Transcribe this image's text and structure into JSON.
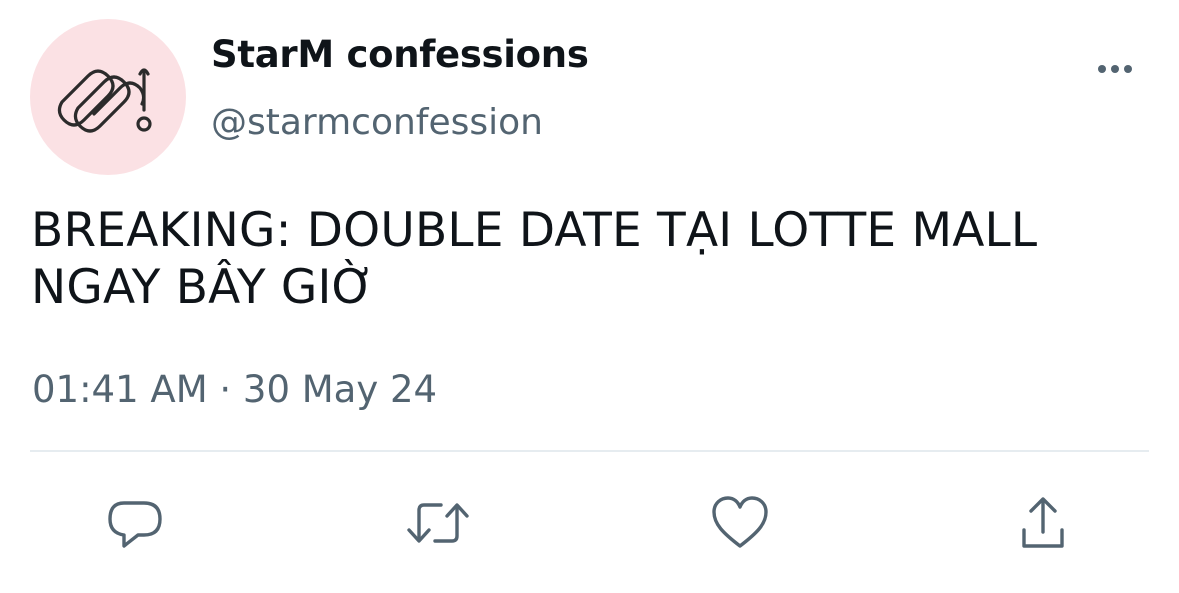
{
  "account": {
    "display_name": "StarM confessions",
    "handle": "@starmconfession",
    "avatar_icon": "starm-logo-icon",
    "avatar_bg": "#fbe1e4"
  },
  "tweet": {
    "text": "BREAKING: DOUBLE DATE TẠI LOTTE MALL NGAY BÂY GIỜ",
    "timestamp": "01:41 AM · 30 May 24"
  },
  "actions": [
    {
      "icon": "reply-icon"
    },
    {
      "icon": "retweet-icon"
    },
    {
      "icon": "like-icon"
    },
    {
      "icon": "share-icon"
    }
  ],
  "menu": {
    "icon": "more-options-icon"
  },
  "colors": {
    "text_primary": "#0f1419",
    "text_secondary": "#536471",
    "divider": "#e6ecf0"
  }
}
